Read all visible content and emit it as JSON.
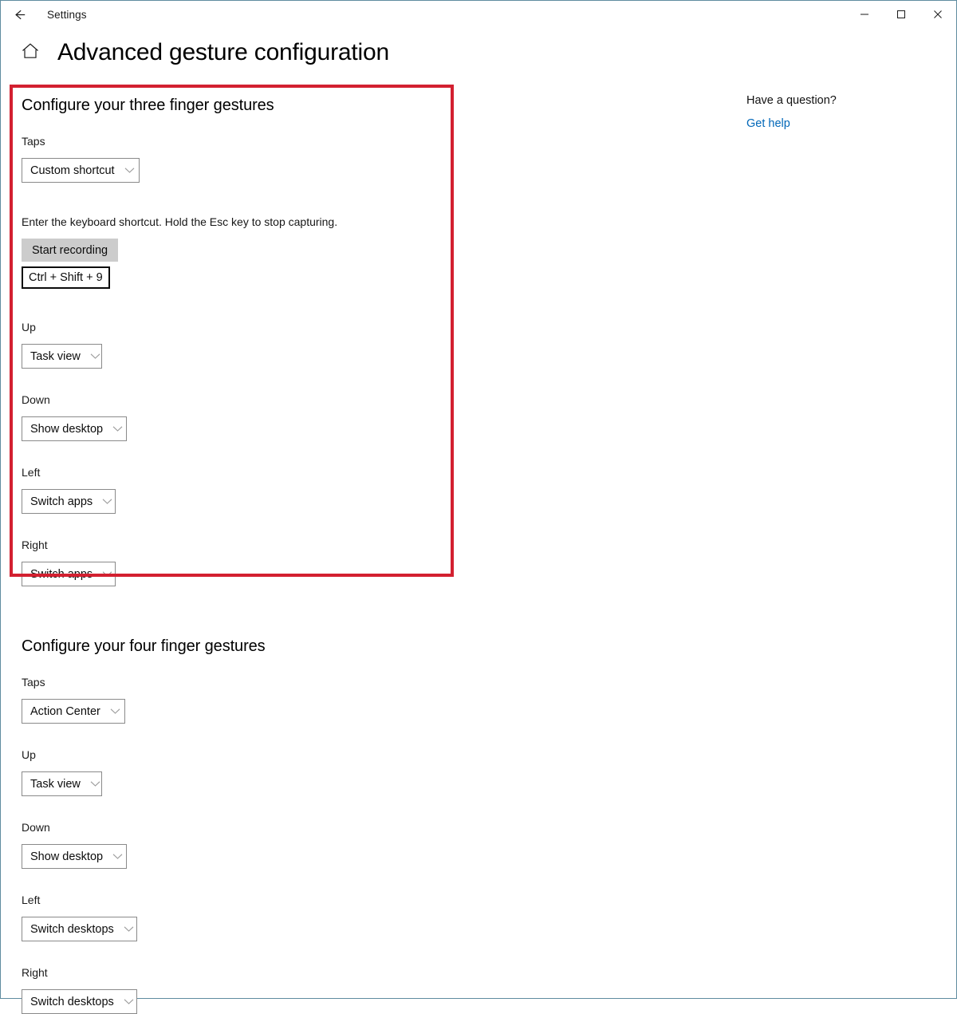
{
  "window": {
    "titlebar_title": "Settings",
    "back_icon": "back-arrow-icon",
    "minimize_icon": "minimize-icon",
    "maximize_icon": "maximize-icon",
    "close_icon": "close-icon"
  },
  "header": {
    "home_icon": "home-icon",
    "page_title": "Advanced gesture configuration"
  },
  "highlight": {
    "color": "#d32030"
  },
  "three_finger": {
    "heading": "Configure your three finger gestures",
    "taps": {
      "label": "Taps",
      "value": "Custom shortcut"
    },
    "shortcut": {
      "hint": "Enter the keyboard shortcut. Hold the Esc key to stop capturing.",
      "record_button": "Start recording",
      "value": "Ctrl + Shift + 9"
    },
    "up": {
      "label": "Up",
      "value": "Task view"
    },
    "down": {
      "label": "Down",
      "value": "Show desktop"
    },
    "left": {
      "label": "Left",
      "value": "Switch apps"
    },
    "right": {
      "label": "Right",
      "value": "Switch apps"
    }
  },
  "four_finger": {
    "heading": "Configure your four finger gestures",
    "taps": {
      "label": "Taps",
      "value": "Action Center"
    },
    "up": {
      "label": "Up",
      "value": "Task view"
    },
    "down": {
      "label": "Down",
      "value": "Show desktop"
    },
    "left": {
      "label": "Left",
      "value": "Switch desktops"
    },
    "right": {
      "label": "Right",
      "value": "Switch desktops"
    }
  },
  "help": {
    "heading": "Have a question?",
    "link": "Get help"
  }
}
